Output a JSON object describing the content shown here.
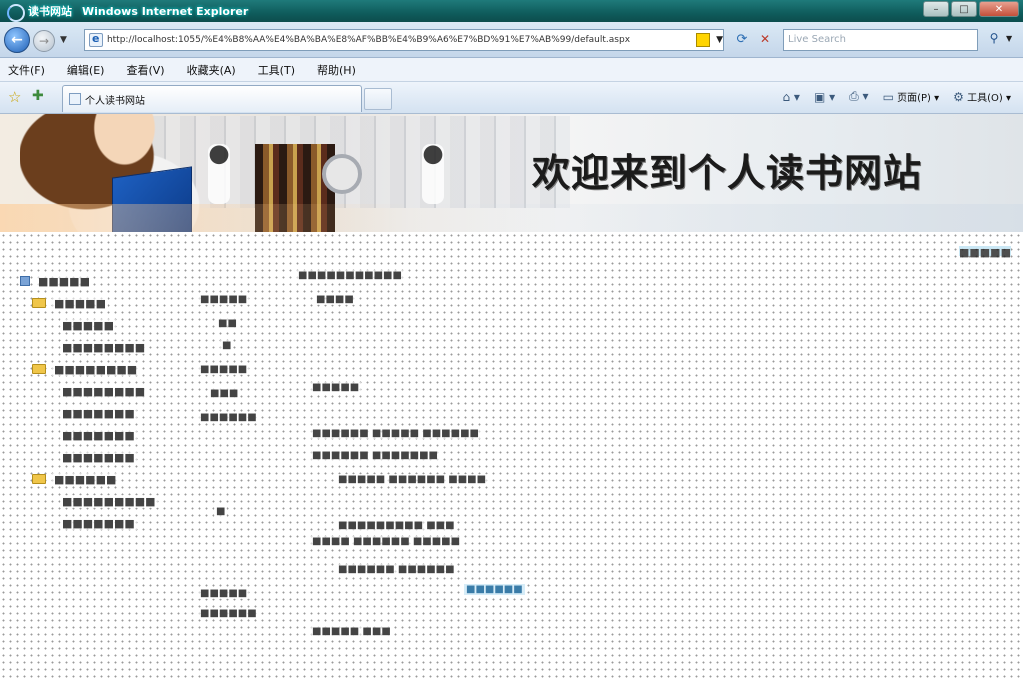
{
  "window": {
    "title_site": "读书网站",
    "title_app": "Windows Internet Explorer",
    "buttons": {
      "minimize": "–",
      "maximize": "□",
      "close": "✕"
    }
  },
  "address": {
    "url": "http://localhost:1055/%E4%B8%AA%E4%BA%BA%E8%AF%BB%E4%B9%A6%E7%BD%91%E7%AB%99/default.aspx",
    "search_placeholder": "Live Search"
  },
  "menu": {
    "items": [
      "文件(F)",
      "编辑(E)",
      "查看(V)",
      "收藏夹(A)",
      "工具(T)",
      "帮助(H)"
    ]
  },
  "tabs": {
    "active_title": "个人读书网站"
  },
  "commandbar": {
    "page_label": "页面(P)",
    "tools_label": "工具(O)"
  },
  "banner": {
    "headline": "欢迎来到个人读书网站"
  },
  "page": {
    "tree": [
      {
        "level": 0,
        "label": "■■■■■",
        "kind": "root"
      },
      {
        "level": 1,
        "label": "■■■■■",
        "kind": "folder"
      },
      {
        "level": 2,
        "label": "■■■■■",
        "kind": "leaf"
      },
      {
        "level": 2,
        "label": "■■■■■■■■",
        "kind": "leaf"
      },
      {
        "level": 1,
        "label": "■■■■■■■■",
        "kind": "folder"
      },
      {
        "level": 2,
        "label": "■■■■■■■■",
        "kind": "leaf"
      },
      {
        "level": 2,
        "label": "■■■■■■■",
        "kind": "leaf"
      },
      {
        "level": 2,
        "label": "■■■■■■■",
        "kind": "leaf"
      },
      {
        "level": 2,
        "label": "■■■■■■■",
        "kind": "leaf"
      },
      {
        "level": 1,
        "label": "■■■■■■",
        "kind": "folder"
      },
      {
        "level": 2,
        "label": "■■■■■■■■■",
        "kind": "leaf"
      },
      {
        "level": 2,
        "label": "■■■■■■■",
        "kind": "leaf"
      }
    ],
    "mid_items": [
      "■■■■■",
      "■■",
      "■",
      "■■■■■",
      "■■■",
      "■■■■■■",
      "■",
      "■■■■■",
      "■■■■■■"
    ],
    "right_items": [
      "■■■■■■■■■■■",
      "■■■■",
      "■■■■■",
      "■■■■■■  ■■■■■ ■■■■■■",
      "■■■■■■  ■■■■■■■",
      "■■■■■  ■■■■■■  ■■■■",
      "■■■■■■■■■  ■■■",
      "■■■■  ■■■■■■  ■■■■■",
      "■■■■■■  ■■■■■■",
      "■■■■■  ■■■"
    ],
    "right_link": "■■■■■■",
    "top_link": "■■■■■"
  }
}
